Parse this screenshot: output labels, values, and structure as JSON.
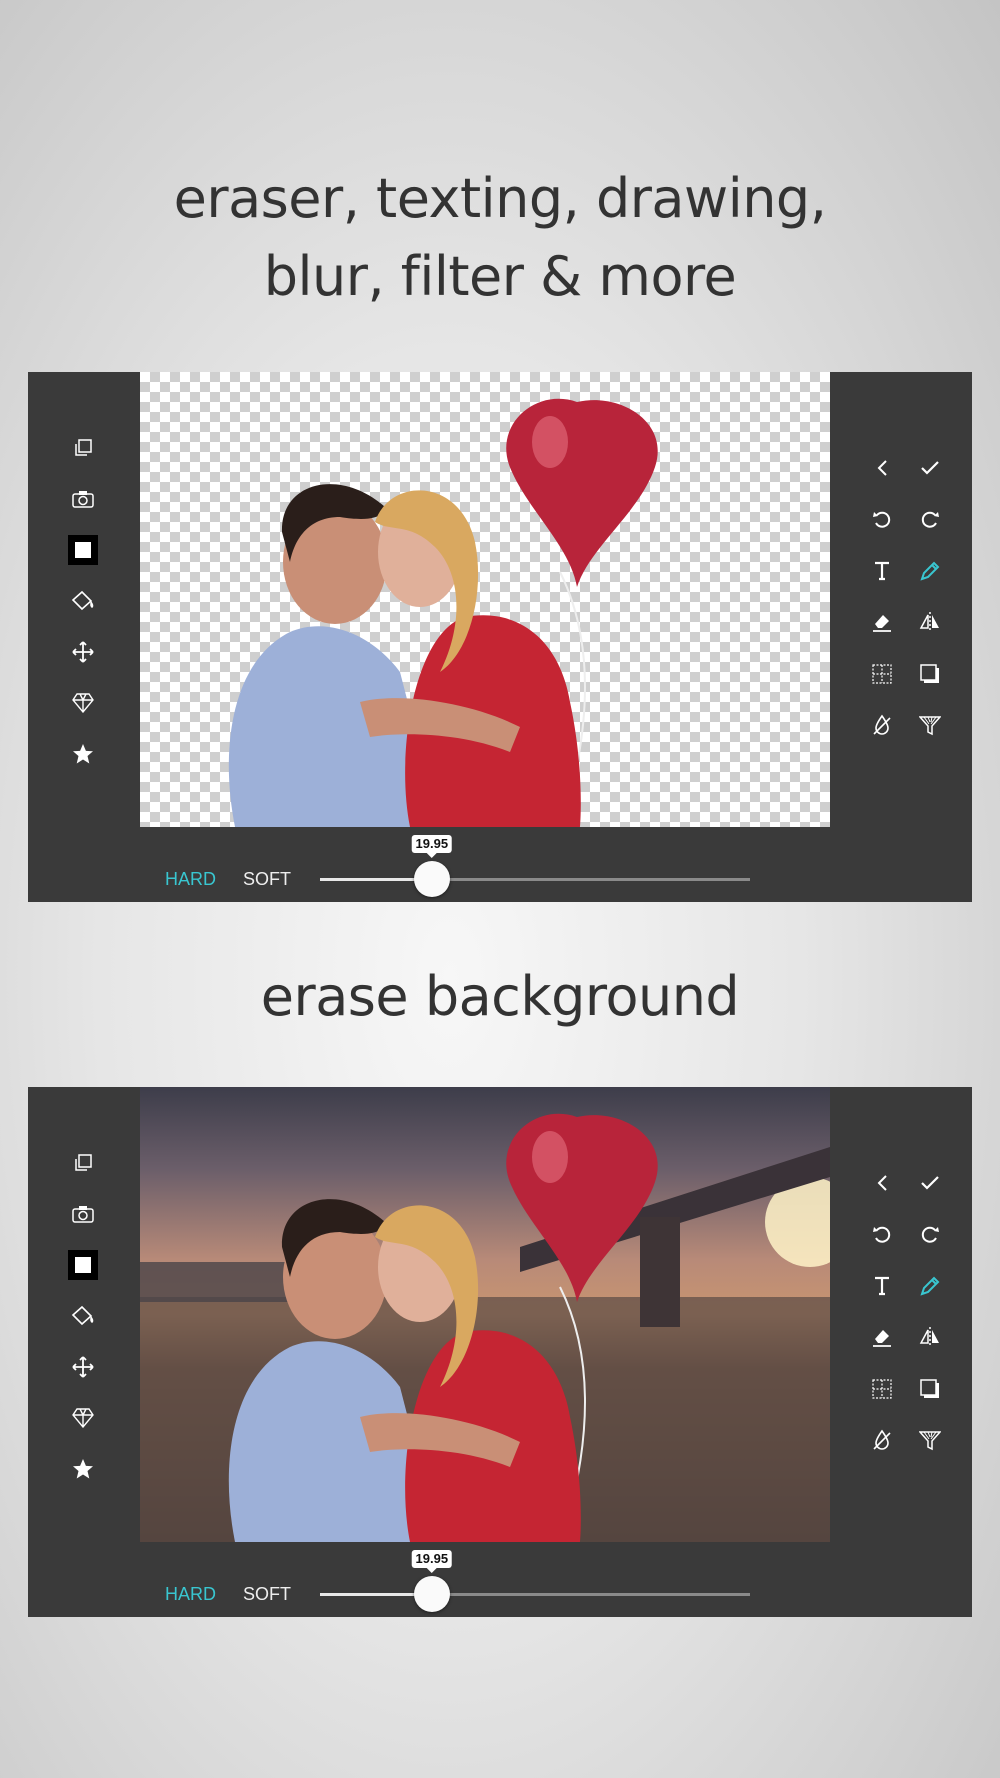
{
  "headline_top": "eraser, texting, drawing,",
  "headline_top_line2": "blur, filter & more",
  "headline_bottom": "erase background",
  "colors": {
    "accent": "#39c6d0",
    "panel": "#3a3a3a",
    "text": "#333333"
  },
  "left_tools": [
    "copy-icon",
    "camera-icon",
    "color-swatch-icon",
    "paint-bucket-icon",
    "move-icon",
    "diamond-icon",
    "star-icon"
  ],
  "right_tools": [
    "back-icon",
    "check-icon",
    "undo-icon",
    "redo-icon",
    "text-icon",
    "pencil-icon",
    "eraser-icon",
    "flip-icon",
    "grid-icon",
    "shadow-icon",
    "blur-icon",
    "filter-icon"
  ],
  "editors": [
    {
      "canvas": "transparent",
      "hard_label": "HARD",
      "soft_label": "SOFT",
      "brush_size": "19.95",
      "slider_fraction": 0.26
    },
    {
      "canvas": "photo",
      "hard_label": "HARD",
      "soft_label": "SOFT",
      "brush_size": "19.95",
      "slider_fraction": 0.26
    }
  ]
}
